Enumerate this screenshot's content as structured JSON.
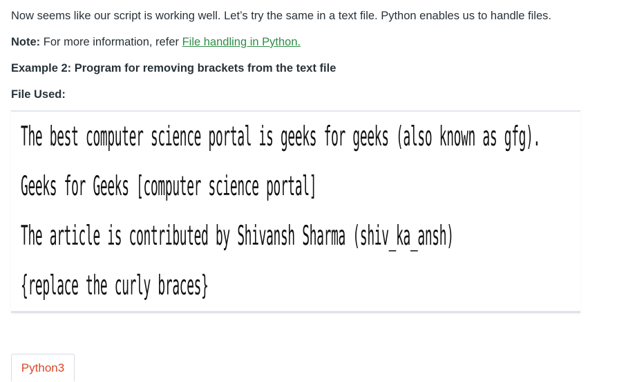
{
  "article": {
    "intro_text": "Now seems like our script is working well. Let’s try the same in a text file. Python enables us to handle files.",
    "note_label": "Note:",
    "note_text": " For more information, refer ",
    "note_link": "File handling in Python.",
    "example_heading": "Example 2: Program for removing brackets from the text file",
    "file_used_label": "File Used:"
  },
  "file_contents": {
    "lines": [
      "The best computer science portal is geeks for geeks (also known as gfg).",
      "Geeks for Geeks [computer science portal]",
      "The article is contributed by Shivansh Sharma (shiv_ka_ansh)",
      "{replace the curly braces}"
    ]
  },
  "code_tabs": {
    "active_tab": "Python3"
  },
  "colors": {
    "text": "#273239",
    "link": "#2f8d46",
    "tab_text": "#d9482b"
  }
}
